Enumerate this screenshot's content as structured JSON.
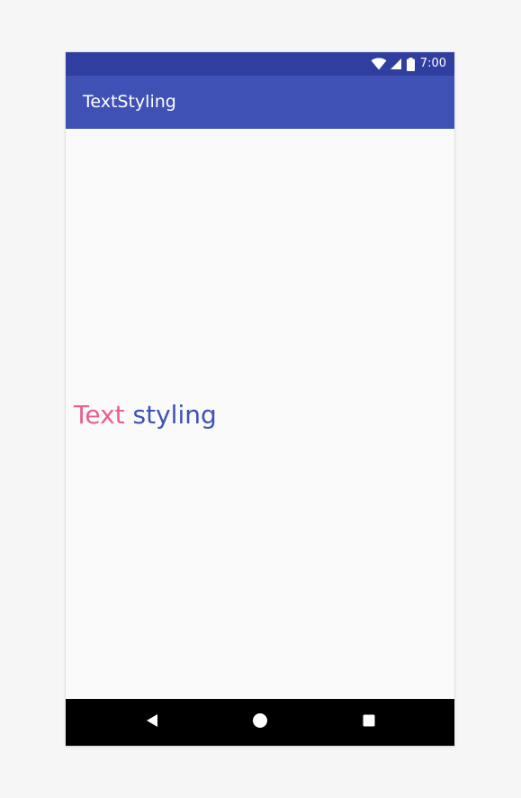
{
  "status_bar": {
    "time": "7:00",
    "icons": [
      "wifi-icon",
      "signal-icon",
      "battery-icon"
    ]
  },
  "app_bar": {
    "title": "TextStyling"
  },
  "content": {
    "text_first": "Text",
    "text_second": "styling"
  },
  "nav_bar": {
    "buttons": [
      "back-icon",
      "home-icon",
      "recent-apps-icon"
    ]
  },
  "colors": {
    "status_bar": "#303f9f",
    "app_bar": "#3f51b5",
    "text_first": "#e8608f",
    "text_second": "#3f51b5",
    "nav_bar": "#000000"
  }
}
